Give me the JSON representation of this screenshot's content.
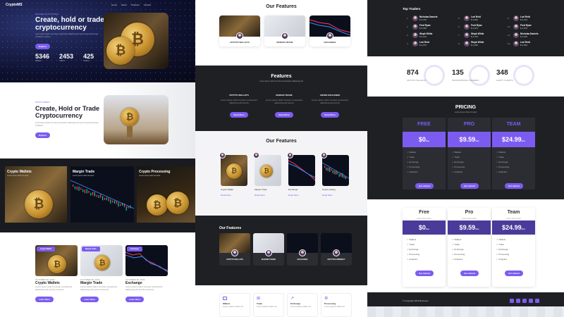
{
  "colors": {
    "accent": "#7c5cf0",
    "dark": "#1f2024",
    "navy": "#4a3a9a"
  },
  "hero": {
    "brand": "CryptoMS",
    "nav": [
      "Home",
      "About",
      "Products",
      "Contact"
    ],
    "kicker": "EXPLORE CRYPTO WORLD",
    "title_l1": "Create, hold or trade",
    "title_l2": "cryptocurrency",
    "desc": "Lorem ipsum dolor sit amet consectetur adipiscing elit sed do eiusmod tempor incididunt ut labore",
    "button": "Explore",
    "stats": [
      {
        "value": "5346",
        "label": "Wallets"
      },
      {
        "value": "2453",
        "label": "Clients"
      },
      {
        "value": "425",
        "label": "Traders"
      }
    ]
  },
  "hero2": {
    "kicker": "CRYPTO WORLD",
    "title_l1": "Create, Hold or Trade",
    "title_l2": "Cryptocurrency",
    "desc": "Lorem ipsum dolor sit amet consectetur adipiscing elit sed do eiusmod tempor incididunt",
    "button": "Explore"
  },
  "tiles": [
    {
      "title": "Crypto Wallets",
      "sub": "Lorem ipsum dolor sit amet"
    },
    {
      "title": "Margin Trade",
      "sub": "Lorem ipsum dolor sit amet"
    },
    {
      "title": "Crypto Processing",
      "sub": "Lorem ipsum dolor sit amet"
    }
  ],
  "blog": [
    {
      "tag": "Crypto Wallet",
      "date": "OCTOBER 28, 2023",
      "title": "Crypto Wallets",
      "desc": "Lorem ipsum dolor sit amet consectetur adipiscing elit sed do eiusmod",
      "btn": "Learn More"
    },
    {
      "tag": "Margin Trade",
      "date": "OCTOBER 28, 2023",
      "title": "Margin Trade",
      "desc": "Lorem ipsum dolor sit amet consectetur adipiscing elit sed do eiusmod",
      "btn": "Learn More"
    },
    {
      "tag": "Exchange",
      "date": "OCTOBER 28, 2023",
      "title": "Exchange",
      "desc": "Lorem ipsum dolor sit amet consectetur adipiscing elit sed do eiusmod",
      "btn": "Learn More"
    }
  ],
  "features1": {
    "title": "Our Features",
    "cards": [
      "CRYPTO WALLETS",
      "MARGIN TRADE",
      "EXCHANGE"
    ]
  },
  "features2": {
    "title": "Features",
    "sub": "Lorem ipsum dolor sit amet consectetur adipiscing elit",
    "cards": [
      {
        "title": "CRYPTO WALLETS",
        "desc": "Lorem ipsum dolor sit amet consectetur adipiscing elit sed do",
        "btn": "Read More"
      },
      {
        "title": "MARGIN TRADE",
        "desc": "Lorem ipsum dolor sit amet consectetur adipiscing elit sed do",
        "btn": "Read More"
      },
      {
        "title": "CRUDE EXCHANGE",
        "desc": "Lorem ipsum dolor sit amet consectetur adipiscing elit sed do",
        "btn": "Read More"
      }
    ]
  },
  "features3": {
    "title": "Our Features",
    "cards": [
      {
        "title": "Crypto Wallet",
        "link": "Read More"
      },
      {
        "title": "Margin Trade",
        "link": "Read More"
      },
      {
        "title": "Exchange",
        "link": "Read More"
      },
      {
        "title": "Crypto trading",
        "link": "Read More"
      }
    ]
  },
  "features4": {
    "title": "Our Features",
    "cards": [
      "CRYPTO WALLETS",
      "MARGIN TRADE",
      "EXCHANGE",
      "CRYPTOCURRENCY"
    ]
  },
  "features5": {
    "cards": [
      {
        "title": "Wallets",
        "desc": "Lorem ipsum dolor sit"
      },
      {
        "title": "Trade",
        "desc": "Lorem ipsum dolor sit"
      },
      {
        "title": "Exchange",
        "desc": "Lorem ipsum dolor sit"
      },
      {
        "title": "Processing",
        "desc": "Lorem ipsum dolor sit"
      }
    ]
  },
  "traders": {
    "title": "Top Traders",
    "list": [
      {
        "rank": "1",
        "name": "Nicholas Daniels",
        "val": "$ 3,476"
      },
      {
        "rank": "2",
        "name": "Fred Ryan",
        "val": "$ 3,346"
      },
      {
        "rank": "3",
        "name": "Steph White",
        "val": "$ 3,134"
      },
      {
        "rank": "4",
        "name": "Lori Reid",
        "val": "$ 2,976"
      },
      {
        "rank": "5",
        "name": "Lori Reid",
        "val": "$ 2,834"
      },
      {
        "rank": "6",
        "name": "Fred Ryan",
        "val": "$ 2,674"
      },
      {
        "rank": "7",
        "name": "Steph White",
        "val": "$ 2,476"
      },
      {
        "rank": "8",
        "name": "Steph White",
        "val": "$ 2,346"
      },
      {
        "rank": "9",
        "name": "Lori Reid",
        "val": "$ 2,134"
      },
      {
        "rank": "10",
        "name": "Fred Ryan",
        "val": "$ 2,076"
      },
      {
        "rank": "11",
        "name": "Nicholas Daniels",
        "val": "$ 1,976"
      },
      {
        "rank": "12",
        "name": "Lori Reid",
        "val": "$ 1,834"
      }
    ]
  },
  "stats": [
    {
      "value": "874",
      "label": "CRYPTO WALLETS"
    },
    {
      "value": "135",
      "label": "PROFESSIONAL TRADERS"
    },
    {
      "value": "348",
      "label": "HAPPY CLIENTS"
    }
  ],
  "pricing": {
    "title": "PRICING",
    "sub": "Lorem ipsum dolor sit amet",
    "plans": [
      {
        "name": "FREE",
        "price": "0",
        "unit": "/mo",
        "items": [
          "Wallets",
          "Trade",
          "Exchange",
          "Processing",
          "Analytics"
        ],
        "btn": "Get started"
      },
      {
        "name": "PRO",
        "price": "9.59",
        "unit": "/mo",
        "items": [
          "Wallets",
          "Trade",
          "Exchange",
          "Processing",
          "Analytics"
        ],
        "btn": "Get started"
      },
      {
        "name": "TEAM",
        "price": "24.99",
        "unit": "/mo",
        "items": [
          "Wallets",
          "Trade",
          "Exchange",
          "Processing",
          "Analytics"
        ],
        "btn": "Get started"
      }
    ]
  },
  "pricing2": {
    "plans": [
      {
        "name": "Free",
        "sub": "Lorem ipsum dolor",
        "price": "0",
        "unit": "/mo",
        "items": [
          "Wallets",
          "Trade",
          "Exchange",
          "Processing",
          "Analytics"
        ],
        "btn": "Get started"
      },
      {
        "name": "Pro",
        "sub": "Lorem ipsum dolor",
        "price": "9.59",
        "unit": "/mo",
        "items": [
          "Wallets",
          "Trade",
          "Exchange",
          "Processing",
          "Analytics"
        ],
        "btn": "Get started"
      },
      {
        "name": "Team",
        "sub": "Lorem ipsum dolor",
        "price": "24.99",
        "unit": "/mo",
        "items": [
          "Wallets",
          "Trade",
          "Exchange",
          "Processing",
          "Analytics"
        ],
        "btn": "Get started"
      }
    ]
  },
  "footer": {
    "copy": "© Copyright 2023 Business",
    "icons": [
      "twitter-icon",
      "facebook-icon",
      "linkedin-icon",
      "instagram-icon",
      "mail-icon"
    ]
  }
}
